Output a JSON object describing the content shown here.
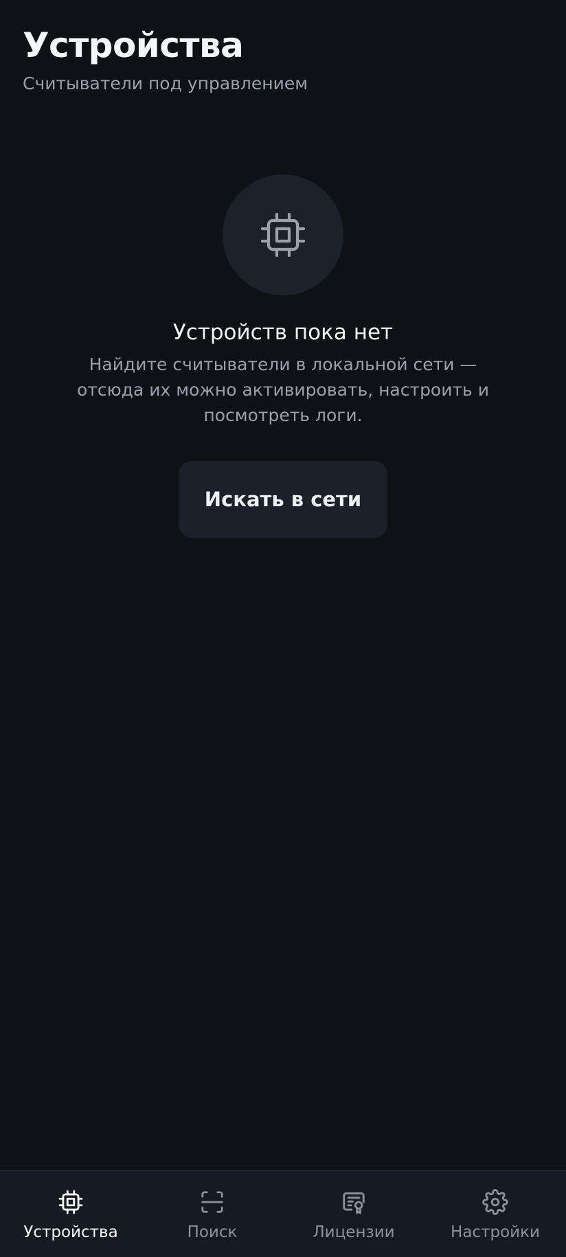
{
  "header": {
    "title": "Устройства",
    "subtitle": "Считыватели под управлением"
  },
  "empty_state": {
    "icon": "chip-icon",
    "title": "Устройств пока нет",
    "description": "Найдите считыватели в локальной сети — отсюда их можно активировать, настроить и посмотреть логи.",
    "button_label": "Искать в сети"
  },
  "nav": {
    "items": [
      {
        "label": "Устройства",
        "icon": "chip-icon",
        "active": true
      },
      {
        "label": "Поиск",
        "icon": "scan-icon",
        "active": false
      },
      {
        "label": "Лицензии",
        "icon": "certificate-icon",
        "active": false
      },
      {
        "label": "Настройки",
        "icon": "gear-icon",
        "active": false
      }
    ]
  },
  "colors": {
    "background": "#0e1116",
    "surface": "#1c222b",
    "nav_background": "#161b22",
    "text_primary": "#f4f6f8",
    "text_secondary": "#9aa1ab"
  }
}
